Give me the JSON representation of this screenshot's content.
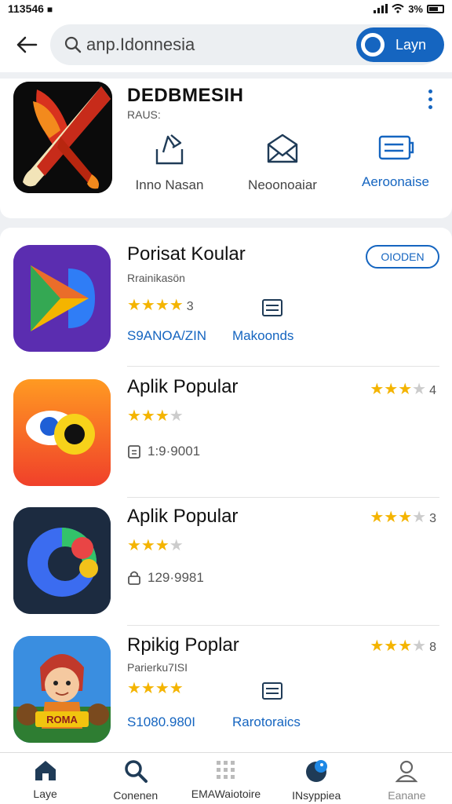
{
  "status": {
    "time": "113546",
    "battery": "3%"
  },
  "header": {
    "search_value": "anp.Idonnesia",
    "toggle_label": "Layn"
  },
  "featured": {
    "title": "DEDBMESIH",
    "subtitle": "RAUS:",
    "actions": [
      {
        "label": "Inno Nasan",
        "icon": "share-icon"
      },
      {
        "label": "Neoonoaiar",
        "icon": "mail-icon"
      },
      {
        "label": "Aeroonaise",
        "icon": "folder-icon"
      }
    ]
  },
  "apps": [
    {
      "name": "Porisat Koular",
      "developer": "Rrainikasön",
      "rating": 4,
      "rating_label": "3",
      "meta": "S9ANOA/ZIN",
      "link": "Makoonds",
      "button": "OIODEN"
    },
    {
      "name": "Aplik Popular",
      "rating": 3.5,
      "rating_label": "4",
      "meta": "1:9·9001"
    },
    {
      "name": "Aplik Popular",
      "rating": 3.5,
      "rating_label": "3",
      "meta": "129·9981"
    },
    {
      "name": "Rpikig Poplar",
      "developer": "Parierku7ISI",
      "rating": 4,
      "rating_label": "8",
      "meta": "S1080.980I",
      "link": "Rarotoraics",
      "badge_text": "ROMA"
    }
  ],
  "nav": [
    {
      "label": "Laye",
      "icon": "home-icon"
    },
    {
      "label": "Conenen",
      "icon": "search-icon"
    },
    {
      "label": "EMAWaiotoire",
      "icon": "apps-grid-icon"
    },
    {
      "label": "INsyppiea",
      "icon": "notification-icon"
    },
    {
      "label": "Eanane",
      "icon": "profile-icon"
    }
  ],
  "colors": {
    "accent": "#1565c0",
    "star": "#f4b400"
  }
}
